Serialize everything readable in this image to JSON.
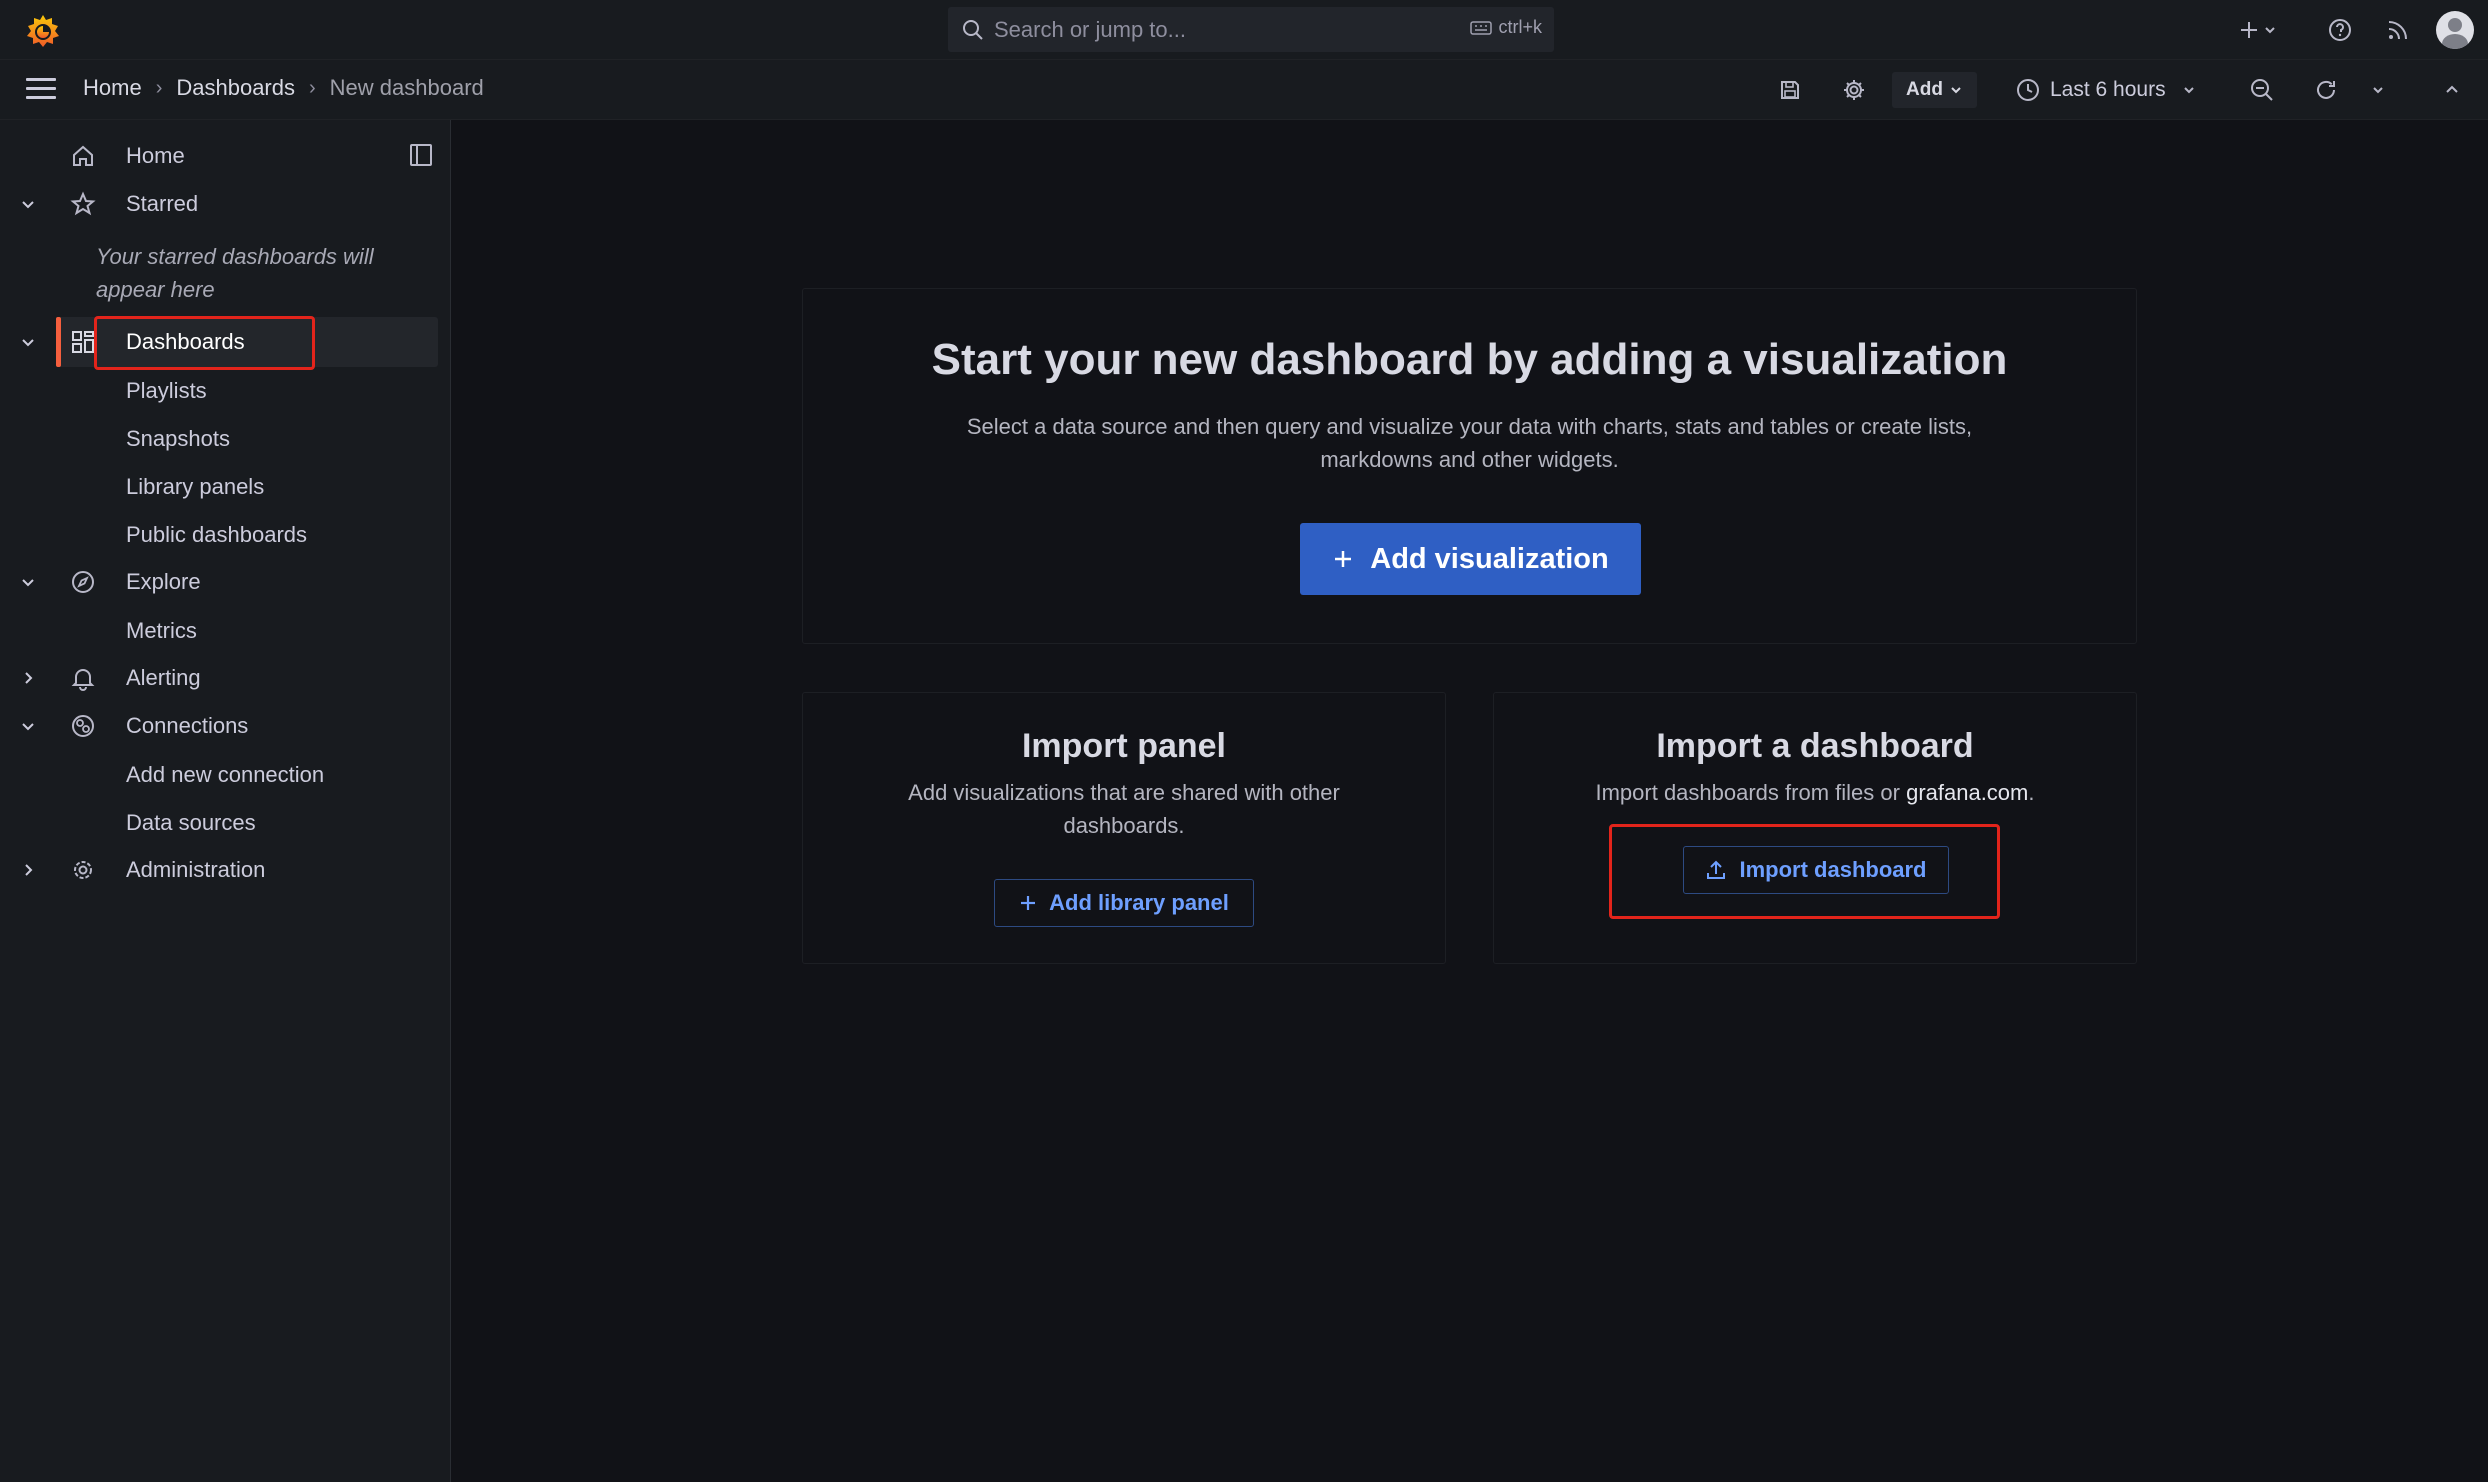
{
  "topbar": {
    "search_placeholder": "Search or jump to...",
    "search_shortcut": "ctrl+k"
  },
  "breadcrumb": {
    "items": [
      "Home",
      "Dashboards",
      "New dashboard"
    ]
  },
  "toolbar": {
    "add_label": "Add",
    "time_range": "Last 6 hours"
  },
  "sidebar": {
    "home": "Home",
    "starred": "Starred",
    "starred_hint": "Your starred dashboards will appear here",
    "dashboards": "Dashboards",
    "playlists": "Playlists",
    "snapshots": "Snapshots",
    "library_panels": "Library panels",
    "public_dashboards": "Public dashboards",
    "explore": "Explore",
    "metrics": "Metrics",
    "alerting": "Alerting",
    "connections": "Connections",
    "add_new_connection": "Add new connection",
    "data_sources": "Data sources",
    "administration": "Administration"
  },
  "main": {
    "hero_title": "Start your new dashboard by adding a visualization",
    "hero_desc_line1": "Select a data source and then query and visualize your data with charts, stats and tables or create lists,",
    "hero_desc_line2": "markdowns and other widgets.",
    "add_visualization": "Add visualization",
    "import_panel_title": "Import panel",
    "import_panel_desc_line1": "Add visualizations that are shared with other",
    "import_panel_desc_line2": "dashboards.",
    "add_library_panel": "Add library panel",
    "import_dashboard_title": "Import a dashboard",
    "import_dashboard_desc": "Import dashboards from files or",
    "import_dashboard_link": "grafana.com",
    "import_dashboard_period": ".",
    "import_dashboard_button": "Import dashboard"
  },
  "colors": {
    "accent_orange": "#f55f3e",
    "primary_blue": "#2f5fc4",
    "highlight_red": "#e3241b"
  }
}
